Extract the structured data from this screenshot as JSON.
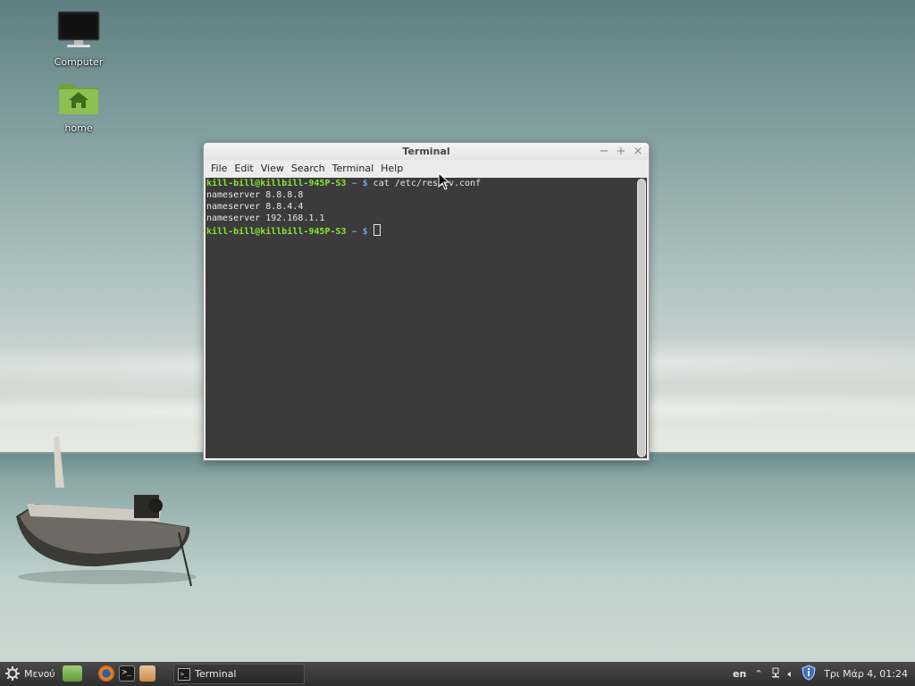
{
  "desktop": {
    "icons": [
      {
        "label": "Computer",
        "icon": "monitor-icon"
      },
      {
        "label": "home",
        "icon": "home-folder-icon"
      }
    ]
  },
  "window": {
    "title": "Terminal",
    "buttons": {
      "minimize": "−",
      "maximize": "+",
      "close": "×"
    },
    "menu": [
      "File",
      "Edit",
      "View",
      "Search",
      "Terminal",
      "Help"
    ]
  },
  "terminal": {
    "prompt_user": "kill-bill@killbill-945P-S3",
    "prompt_path": "~ $",
    "command": "cat /etc/resolv.conf",
    "output": [
      "nameserver 8.8.8.8",
      "nameserver 8.8.4.4",
      "nameserver 192.168.1.1"
    ]
  },
  "taskbar": {
    "menu_label": "Μενού",
    "launchers": [
      "show-desktop-icon",
      "firefox-icon",
      "terminal-icon",
      "files-icon"
    ],
    "task_label": "Terminal",
    "tray": {
      "keyboard_layout": "en",
      "datetime": "Τρι Μάρ  4, 01:24"
    }
  },
  "colors": {
    "prompt_green": "#8ae234",
    "prompt_blue": "#729fcf",
    "terminal_bg": "#3b3b3b"
  }
}
